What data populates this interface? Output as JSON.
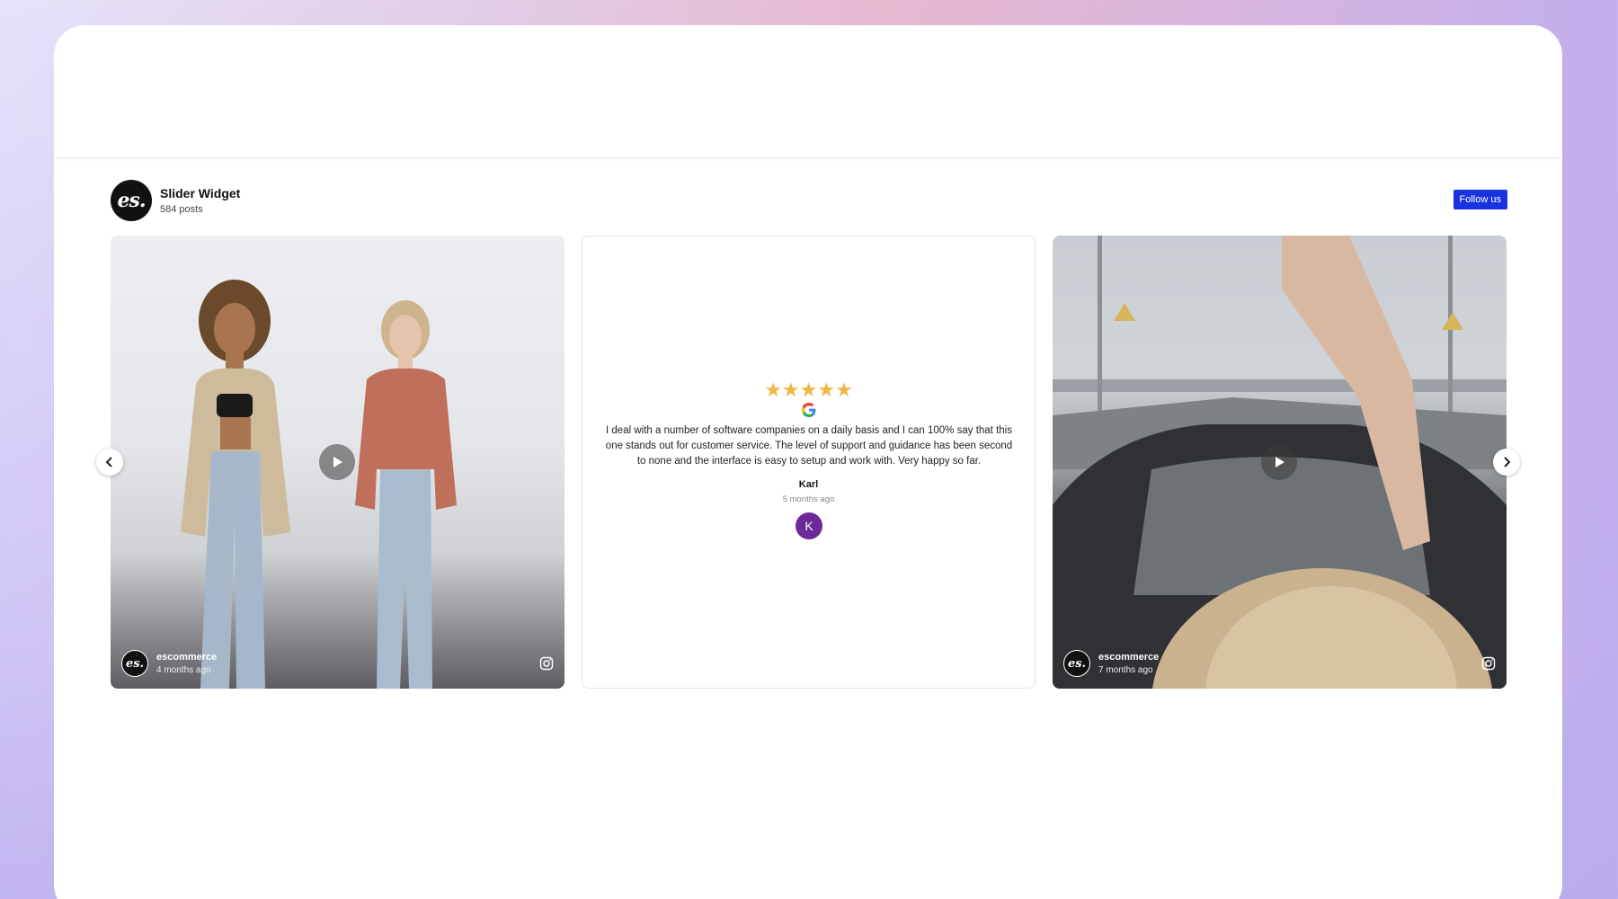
{
  "widget": {
    "title": "Slider Widget",
    "posts": "584 posts",
    "follow_label": "Follow us",
    "logo_text": "es."
  },
  "cards": [
    {
      "type": "video",
      "user": "escommerce",
      "time": "4 months ago",
      "avatar_text": "es."
    },
    {
      "type": "review",
      "rating": "★★★★★",
      "text": "I deal with a number of software companies on a daily basis and I can 100% say that this one stands out for customer service. The level of support and guidance has been second to none and the interface is easy to setup and work with. Very happy so far.",
      "reviewer": "Karl",
      "time": "5 months ago",
      "avatar_letter": "K"
    },
    {
      "type": "video",
      "user": "escommerce",
      "time": "7 months ago",
      "avatar_text": "es."
    }
  ],
  "colors": {
    "follow_button": "#1a33e0",
    "star": "#f0b840",
    "reviewer_avatar": "#6c2a98"
  },
  "icons": [
    "play-icon",
    "instagram-icon",
    "google-icon",
    "chevron-left-icon",
    "chevron-right-icon"
  ]
}
